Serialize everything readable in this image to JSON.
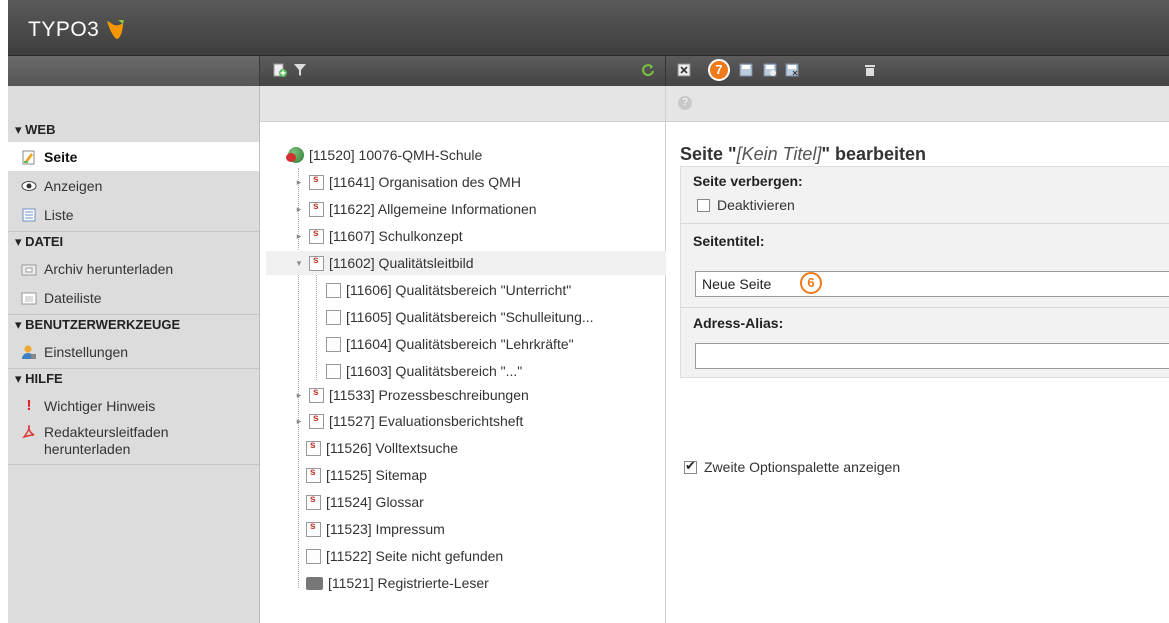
{
  "app": {
    "logo_text": "TYPO3"
  },
  "toolbar": {
    "tree_icons": [
      "new-page-icon",
      "filter-icon",
      "refresh-icon"
    ],
    "edit_icons": [
      "close-icon",
      "save-icon",
      "save-view-icon",
      "save-close-icon",
      "delete-icon"
    ]
  },
  "module_menu": {
    "sections": [
      {
        "title": "▾ WEB",
        "items": [
          {
            "label": "Seite",
            "icon": "page-module-icon",
            "active": true
          },
          {
            "label": "Anzeigen",
            "icon": "eye-icon"
          },
          {
            "label": "Liste",
            "icon": "list-icon"
          }
        ]
      },
      {
        "title": "▾ DATEI",
        "items": [
          {
            "label": "Archiv herunterladen",
            "icon": "archive-icon"
          },
          {
            "label": "Dateiliste",
            "icon": "filelist-icon"
          }
        ]
      },
      {
        "title": "▾ BENUTZERWERKZEUGE",
        "items": [
          {
            "label": "Einstellungen",
            "icon": "user-settings-icon"
          }
        ]
      },
      {
        "title": "▾ HILFE",
        "items": [
          {
            "label": "Wichtiger Hinweis",
            "icon": "exclamation-icon"
          },
          {
            "label": "Redakteursleitfaden herunterladen",
            "icon": "pdf-icon"
          }
        ]
      }
    ]
  },
  "tree": {
    "nodes": [
      {
        "label": "[11520] 10076-QMH-Schule"
      },
      {
        "label": "[11641] Organisation des QMH"
      },
      {
        "label": "[11622] Allgemeine Informationen"
      },
      {
        "label": "[11607] Schulkonzept"
      },
      {
        "label": "[11602] Qualitätsleitbild"
      },
      {
        "label": "[11606] Qualitätsbereich \"Unterricht\""
      },
      {
        "label": "[11605] Qualitätsbereich \"Schulleitung..."
      },
      {
        "label": "[11604] Qualitätsbereich \"Lehrkräfte\""
      },
      {
        "label": "[11603] Qualitätsbereich \"...\""
      },
      {
        "label": "[11533] Prozessbeschreibungen"
      },
      {
        "label": "[11527] Evaluationsberichtsheft"
      },
      {
        "label": "[11526] Volltextsuche"
      },
      {
        "label": "[11525] Sitemap"
      },
      {
        "label": "[11524] Glossar"
      },
      {
        "label": "[11523] Impressum"
      },
      {
        "label": "[11522] Seite nicht gefunden"
      },
      {
        "label": "[11521] Registrierte-Leser"
      }
    ]
  },
  "edit": {
    "title_prefix": "Seite \"",
    "title_value": "[Kein Titel]",
    "title_suffix": "\" bearbeiten",
    "hide_label": "Seite verbergen:",
    "hide_checkbox_label": "Deaktivieren",
    "hide_checked": false,
    "pagetitle_label": "Seitentitel:",
    "pagetitle_value": "Neue Seite",
    "alias_label": "Adress-Alias:",
    "alias_value": "",
    "second_palette_label": "Zweite Optionspalette anzeigen",
    "second_palette_checked": true
  },
  "callouts": {
    "save": "7",
    "title_field": "6"
  },
  "colors": {
    "callout": "#f07a1a",
    "topbar": "#4a4a4a"
  }
}
